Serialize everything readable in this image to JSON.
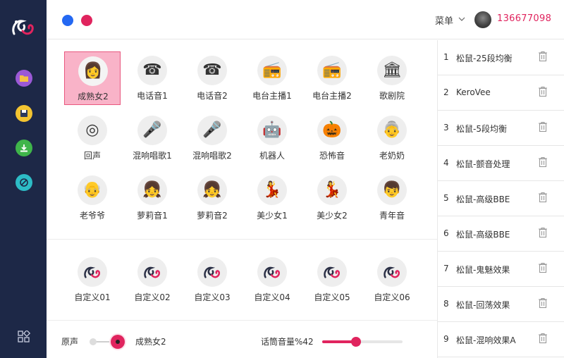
{
  "window": {
    "dot_colors": [
      "#2468f2",
      "#e0245e"
    ]
  },
  "header": {
    "menu_label": "菜单",
    "user_id": "136677098"
  },
  "voices": [
    {
      "label": "成熟女2",
      "icon": "woman-avatar-icon",
      "glyph": "👩",
      "selected": true
    },
    {
      "label": "电话音1",
      "icon": "telephone-icon",
      "glyph": "☎"
    },
    {
      "label": "电话音2",
      "icon": "telephone-icon",
      "glyph": "☎"
    },
    {
      "label": "电台主播1",
      "icon": "radio-icon",
      "glyph": "📻"
    },
    {
      "label": "电台主播2",
      "icon": "radio-icon",
      "glyph": "📻"
    },
    {
      "label": "歌剧院",
      "icon": "opera-house-icon",
      "glyph": "🏛"
    },
    {
      "label": "回声",
      "icon": "echo-icon",
      "glyph": "◎"
    },
    {
      "label": "混响唱歌1",
      "icon": "singer-icon",
      "glyph": "🎤"
    },
    {
      "label": "混响唱歌2",
      "icon": "singer-icon",
      "glyph": "🎤"
    },
    {
      "label": "机器人",
      "icon": "robot-icon",
      "glyph": "🤖"
    },
    {
      "label": "恐怖音",
      "icon": "pumpkin-icon",
      "glyph": "🎃"
    },
    {
      "label": "老奶奶",
      "icon": "grandma-icon",
      "glyph": "👵"
    },
    {
      "label": "老爷爷",
      "icon": "grandpa-icon",
      "glyph": "👴"
    },
    {
      "label": "萝莉音1",
      "icon": "girl-icon",
      "glyph": "👧"
    },
    {
      "label": "萝莉音2",
      "icon": "girl-icon",
      "glyph": "👧"
    },
    {
      "label": "美少女1",
      "icon": "beauty-girl-icon",
      "glyph": "💃"
    },
    {
      "label": "美少女2",
      "icon": "beauty-girl-icon",
      "glyph": "💃"
    },
    {
      "label": "青年音",
      "icon": "young-man-icon",
      "glyph": "👦"
    }
  ],
  "custom_voices": [
    {
      "label": "自定义01",
      "icon": "custom-logo-icon"
    },
    {
      "label": "自定义02",
      "icon": "custom-logo-icon"
    },
    {
      "label": "自定义03",
      "icon": "custom-logo-icon"
    },
    {
      "label": "自定义04",
      "icon": "custom-logo-icon"
    },
    {
      "label": "自定义05",
      "icon": "custom-logo-icon"
    },
    {
      "label": "自定义06",
      "icon": "custom-logo-icon"
    }
  ],
  "bottom": {
    "original_label": "原声",
    "current_voice": "成熟女2",
    "mic_volume_label": "话筒音量%42",
    "mic_volume": 42
  },
  "presets": [
    {
      "index": "1",
      "name": "松鼠-25段均衡"
    },
    {
      "index": "2",
      "name": "KeroVee"
    },
    {
      "index": "3",
      "name": "松鼠-5段均衡"
    },
    {
      "index": "4",
      "name": "松鼠-颤音处理"
    },
    {
      "index": "5",
      "name": "松鼠-高级BBE"
    },
    {
      "index": "6",
      "name": "松鼠-高级BBE"
    },
    {
      "index": "7",
      "name": "松鼠-鬼魅效果"
    },
    {
      "index": "8",
      "name": "松鼠-回荡效果"
    },
    {
      "index": "9",
      "name": "松鼠-混响效果A"
    }
  ],
  "colors": {
    "accent": "#e0245e",
    "sidebar": "#1d2847",
    "selected_bg": "#f9b3c8"
  }
}
